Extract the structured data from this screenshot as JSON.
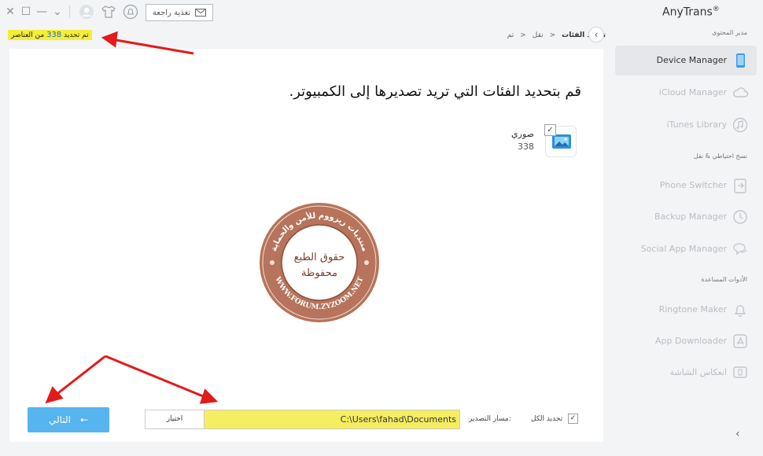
{
  "window": {
    "feedback_label": "تغذية راجعة"
  },
  "status": {
    "prefix": "تم تحديد",
    "count": "338",
    "suffix": "من العناصر"
  },
  "breadcrumb": {
    "items": [
      "تم",
      "نقل",
      "تحديد الفئات"
    ]
  },
  "main": {
    "heading": "قم بتحديد الفئات التي تريد تصديرها إلى الكمبيوتر.",
    "category": {
      "name": "صوري",
      "count": "338",
      "checked": "✓"
    },
    "watermark": {
      "top_text": "منتديات زيزووم للأمن والحماية",
      "bottom_text": "WWW.FORUM.ZYZOOM.NET",
      "center_line1": "حقوق الطبع",
      "center_line2": "محفوظة"
    }
  },
  "footer": {
    "select_all_label": "تحديد الكل",
    "select_all_checked": "✓",
    "export_path_label": "مسار التصدير:",
    "export_path_value": "C:\\Users\\fahad\\Documents",
    "choose_label": "اختيار",
    "next_label": "التالي",
    "next_arrow": "←"
  },
  "sidebar": {
    "brand": "AnyTrans",
    "brand_mark": "®",
    "section1": "مدير المحتوى",
    "section2": "نسخ احتياطي & نقل",
    "section3": "الأدوات المساعدة",
    "items": [
      {
        "label": "Device Manager",
        "icon": "phone-icon"
      },
      {
        "label": "iCloud Manager",
        "icon": "cloud-icon"
      },
      {
        "label": "iTunes Library",
        "icon": "music-icon"
      },
      {
        "label": "Phone Switcher",
        "icon": "switch-icon"
      },
      {
        "label": "Backup Manager",
        "icon": "clock-icon"
      },
      {
        "label": "Social App Manager",
        "icon": "chat-icon"
      },
      {
        "label": "Ringtone Maker",
        "icon": "bell-icon"
      },
      {
        "label": "App Downloader",
        "icon": "appstore-icon"
      },
      {
        "label": "انعكاس الشاشة",
        "icon": "mirror-icon"
      }
    ],
    "collapse": "‹"
  },
  "colors": {
    "accent": "#56b4ee",
    "highlight": "#f4ee37",
    "active_item": "#e5e7ea"
  }
}
